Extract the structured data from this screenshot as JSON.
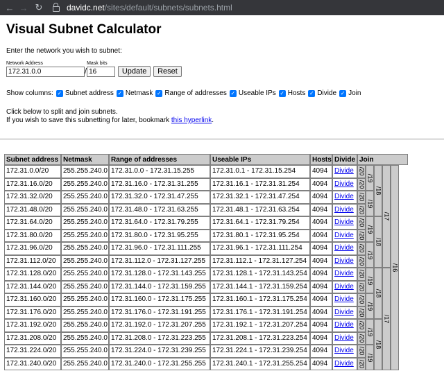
{
  "browser": {
    "url_host": "davidc.net",
    "url_path": "/sites/default/subnets/subnets.html"
  },
  "page": {
    "title": "Visual Subnet Calculator",
    "intro": "Enter the network you wish to subnet:",
    "network_address_label": "Network Address",
    "network_address_value": "172.31.0.0",
    "mask_bits_label": "Mask bits",
    "mask_bits_value": "16",
    "slash": "/",
    "update_label": "Update",
    "reset_label": "Reset",
    "show_columns_label": "Show columns:",
    "checkbox_mark": "✓",
    "columns_toggle": [
      {
        "label": "Subnet address",
        "checked": true
      },
      {
        "label": "Netmask",
        "checked": true
      },
      {
        "label": "Range of addresses",
        "checked": true
      },
      {
        "label": "Useable IPs",
        "checked": true
      },
      {
        "label": "Hosts",
        "checked": true
      },
      {
        "label": "Divide",
        "checked": true
      },
      {
        "label": "Join",
        "checked": true
      }
    ],
    "help_line1": "Click below to split and join subnets.",
    "help_line2_prefix": "If you wish to save this subnetting for later, bookmark ",
    "help_link": "this hyperlink",
    "help_line2_suffix": "."
  },
  "table": {
    "headers": [
      "Subnet address",
      "Netmask",
      "Range of addresses",
      "Useable IPs",
      "Hosts",
      "Divide",
      "Join"
    ],
    "rows": [
      {
        "subnet": "172.31.0.0/20",
        "netmask": "255.255.240.0",
        "range": "172.31.0.0 - 172.31.15.255",
        "useable": "172.31.0.1 - 172.31.15.254",
        "hosts": "4094",
        "divide": "Divide"
      },
      {
        "subnet": "172.31.16.0/20",
        "netmask": "255.255.240.0",
        "range": "172.31.16.0 - 172.31.31.255",
        "useable": "172.31.16.1 - 172.31.31.254",
        "hosts": "4094",
        "divide": "Divide"
      },
      {
        "subnet": "172.31.32.0/20",
        "netmask": "255.255.240.0",
        "range": "172.31.32.0 - 172.31.47.255",
        "useable": "172.31.32.1 - 172.31.47.254",
        "hosts": "4094",
        "divide": "Divide"
      },
      {
        "subnet": "172.31.48.0/20",
        "netmask": "255.255.240.0",
        "range": "172.31.48.0 - 172.31.63.255",
        "useable": "172.31.48.1 - 172.31.63.254",
        "hosts": "4094",
        "divide": "Divide"
      },
      {
        "subnet": "172.31.64.0/20",
        "netmask": "255.255.240.0",
        "range": "172.31.64.0 - 172.31.79.255",
        "useable": "172.31.64.1 - 172.31.79.254",
        "hosts": "4094",
        "divide": "Divide"
      },
      {
        "subnet": "172.31.80.0/20",
        "netmask": "255.255.240.0",
        "range": "172.31.80.0 - 172.31.95.255",
        "useable": "172.31.80.1 - 172.31.95.254",
        "hosts": "4094",
        "divide": "Divide"
      },
      {
        "subnet": "172.31.96.0/20",
        "netmask": "255.255.240.0",
        "range": "172.31.96.0 - 172.31.111.255",
        "useable": "172.31.96.1 - 172.31.111.254",
        "hosts": "4094",
        "divide": "Divide"
      },
      {
        "subnet": "172.31.112.0/20",
        "netmask": "255.255.240.0",
        "range": "172.31.112.0 - 172.31.127.255",
        "useable": "172.31.112.1 - 172.31.127.254",
        "hosts": "4094",
        "divide": "Divide"
      },
      {
        "subnet": "172.31.128.0/20",
        "netmask": "255.255.240.0",
        "range": "172.31.128.0 - 172.31.143.255",
        "useable": "172.31.128.1 - 172.31.143.254",
        "hosts": "4094",
        "divide": "Divide"
      },
      {
        "subnet": "172.31.144.0/20",
        "netmask": "255.255.240.0",
        "range": "172.31.144.0 - 172.31.159.255",
        "useable": "172.31.144.1 - 172.31.159.254",
        "hosts": "4094",
        "divide": "Divide"
      },
      {
        "subnet": "172.31.160.0/20",
        "netmask": "255.255.240.0",
        "range": "172.31.160.0 - 172.31.175.255",
        "useable": "172.31.160.1 - 172.31.175.254",
        "hosts": "4094",
        "divide": "Divide"
      },
      {
        "subnet": "172.31.176.0/20",
        "netmask": "255.255.240.0",
        "range": "172.31.176.0 - 172.31.191.255",
        "useable": "172.31.176.1 - 172.31.191.254",
        "hosts": "4094",
        "divide": "Divide"
      },
      {
        "subnet": "172.31.192.0/20",
        "netmask": "255.255.240.0",
        "range": "172.31.192.0 - 172.31.207.255",
        "useable": "172.31.192.1 - 172.31.207.254",
        "hosts": "4094",
        "divide": "Divide"
      },
      {
        "subnet": "172.31.208.0/20",
        "netmask": "255.255.240.0",
        "range": "172.31.208.0 - 172.31.223.255",
        "useable": "172.31.208.1 - 172.31.223.254",
        "hosts": "4094",
        "divide": "Divide"
      },
      {
        "subnet": "172.31.224.0/20",
        "netmask": "255.255.240.0",
        "range": "172.31.224.0 - 172.31.239.255",
        "useable": "172.31.224.1 - 172.31.239.254",
        "hosts": "4094",
        "divide": "Divide"
      },
      {
        "subnet": "172.31.240.0/20",
        "netmask": "255.255.240.0",
        "range": "172.31.240.0 - 172.31.255.255",
        "useable": "172.31.240.1 - 172.31.255.254",
        "hosts": "4094",
        "divide": "Divide"
      }
    ],
    "join_levels": [
      "/20",
      "/19",
      "/18",
      "/17",
      "/16"
    ]
  }
}
